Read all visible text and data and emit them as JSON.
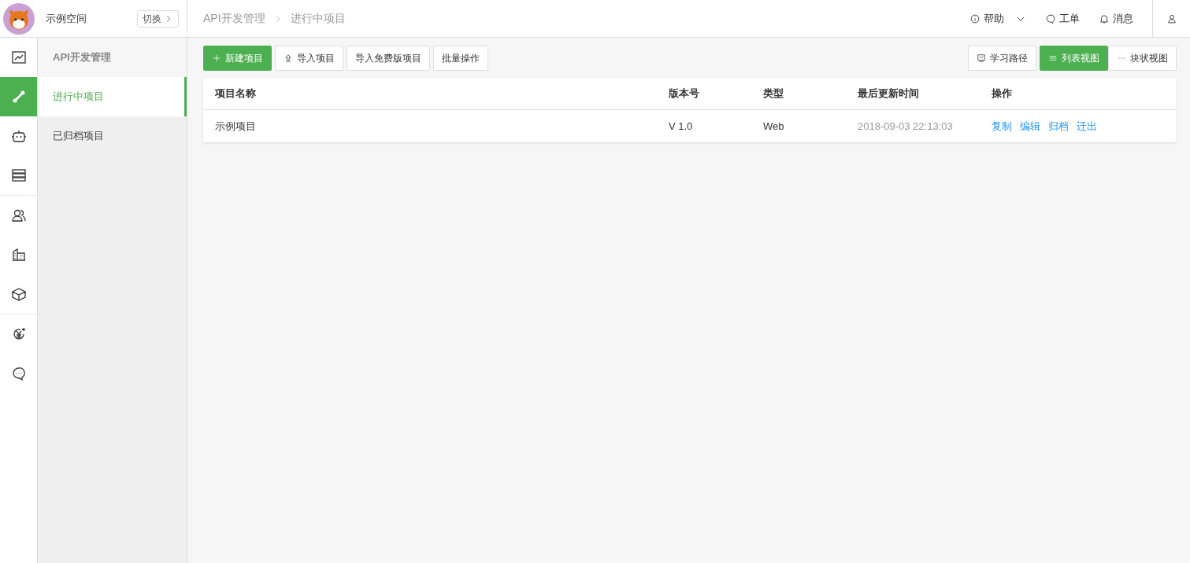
{
  "header": {
    "workspace": "示例空间",
    "switch_button": "切换",
    "breadcrumb": [
      "API开发管理",
      "进行中项目"
    ],
    "links": [
      {
        "kind": "help",
        "label": "帮助"
      },
      {
        "kind": "ticket",
        "label": "工单"
      },
      {
        "kind": "bell",
        "label": "消息"
      }
    ]
  },
  "rail": [
    [
      {
        "kind": "chart",
        "selected": false
      },
      {
        "kind": "link",
        "selected": true
      },
      {
        "kind": "robot",
        "selected": false
      },
      {
        "kind": "server",
        "selected": false
      }
    ],
    [
      {
        "kind": "users",
        "selected": false
      },
      {
        "kind": "building",
        "selected": false
      },
      {
        "kind": "box",
        "selected": false
      }
    ],
    [
      {
        "kind": "yen",
        "selected": false
      },
      {
        "kind": "chat",
        "selected": false
      }
    ]
  ],
  "sidebar": {
    "title": "API开发管理",
    "items": [
      {
        "label": "进行中项目",
        "selected": true
      },
      {
        "label": "已归档项目",
        "selected": false
      }
    ]
  },
  "toolbar": {
    "buttons": [
      {
        "kind": "primary",
        "label": "新建项目"
      },
      {
        "kind": "import",
        "label": "导入项目"
      },
      {
        "kind": "plain",
        "label": "导入免费版项目"
      },
      {
        "kind": "plain",
        "label": "批量操作"
      }
    ],
    "learn": "学习路径",
    "views": [
      {
        "kind": "list",
        "label": "列表视图",
        "selected": true
      },
      {
        "kind": "block",
        "label": "块状视图",
        "selected": false
      }
    ]
  },
  "table": {
    "columns": [
      "项目名称",
      "版本号",
      "类型",
      "最后更新时间",
      "操作"
    ],
    "rows": [
      {
        "name": "示例项目",
        "version": "V 1.0",
        "type": "Web",
        "updated": "2018-09-03 22:13:03",
        "actions": [
          "复制",
          "编辑",
          "归档",
          "迁出"
        ]
      }
    ]
  }
}
